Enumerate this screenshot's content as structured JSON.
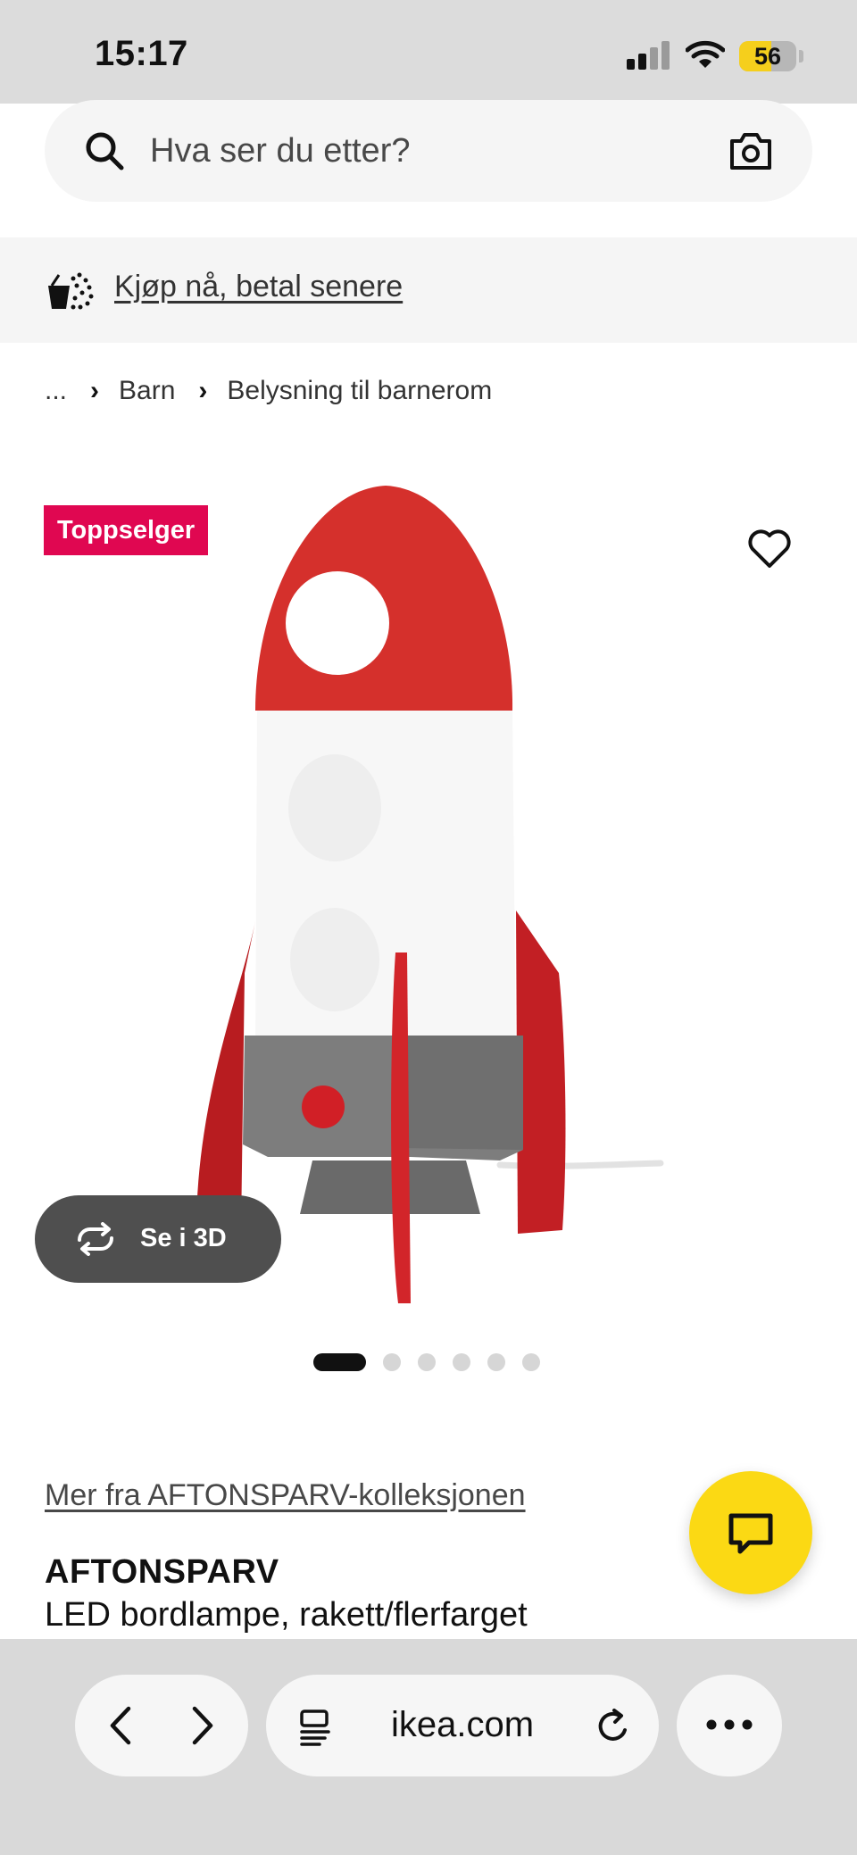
{
  "status_bar": {
    "time": "15:17",
    "battery_level": "56",
    "battery_fraction": 0.56,
    "icons": [
      "signal-icon",
      "wifi-icon",
      "battery-icon"
    ]
  },
  "search": {
    "placeholder": "Hva ser du etter?",
    "icons": [
      "search-icon",
      "camera-icon"
    ]
  },
  "promo": {
    "link_label": "Kjøp nå, betal senere",
    "icon": "basket-icon"
  },
  "breadcrumb": {
    "items": [
      "...",
      "Barn",
      "Belysning til barnerom"
    ],
    "separator": "›"
  },
  "product": {
    "badge": "Toppselger",
    "badge_color": "#e00751",
    "view_3d_label": "Se i 3D",
    "image_count": 6,
    "active_image_index": 0,
    "collection_link": "Mer fra AFTONSPARV-kolleksjonen",
    "name": "AFTONSPARV",
    "description": "LED bordlampe, rakett/flerfarget"
  },
  "chat": {
    "icon": "chat-icon",
    "color": "#fbd914"
  },
  "browser": {
    "url": "ikea.com",
    "icons": [
      "back-icon",
      "forward-icon",
      "reader-icon",
      "reload-icon",
      "more-icon"
    ]
  }
}
